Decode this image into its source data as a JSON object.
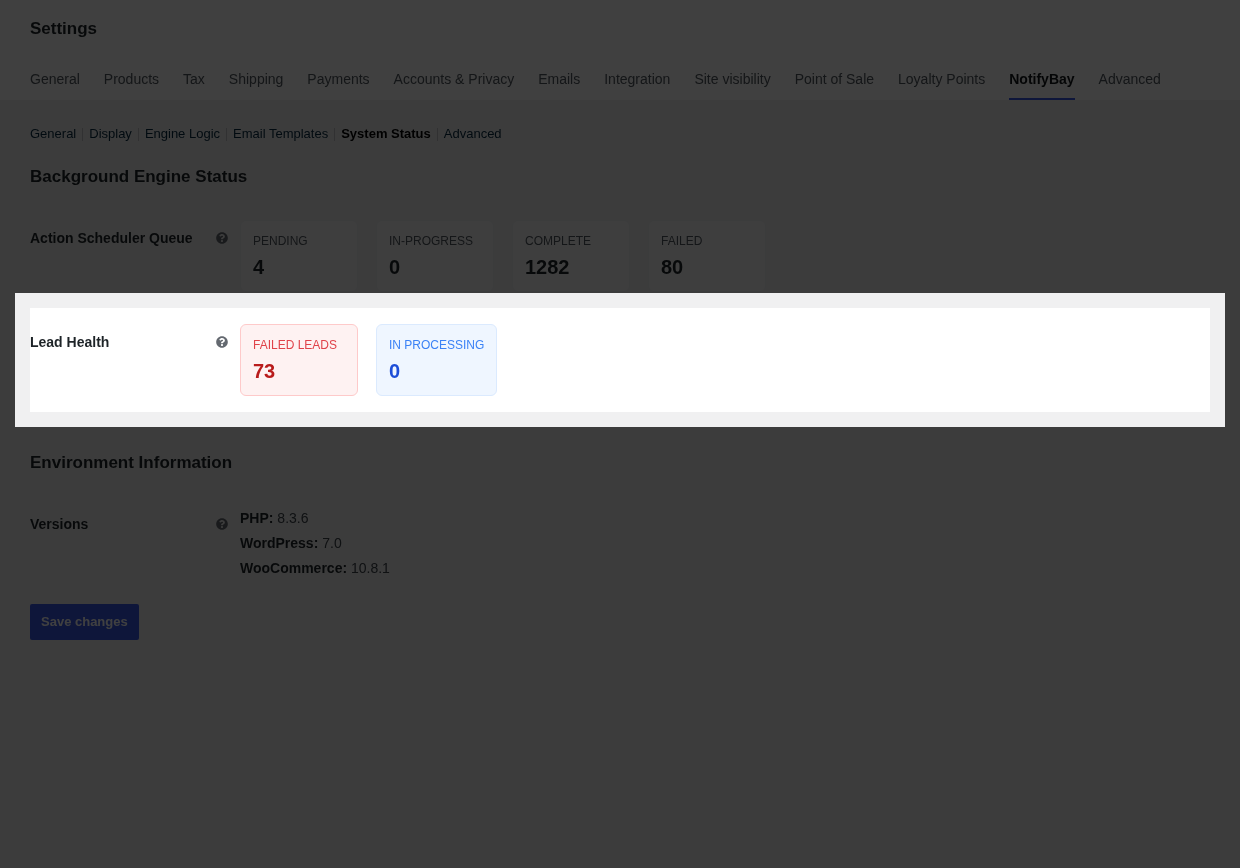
{
  "page_title": "Settings",
  "tabs": [
    {
      "label": "General",
      "selected": false
    },
    {
      "label": "Products",
      "selected": false
    },
    {
      "label": "Tax",
      "selected": false
    },
    {
      "label": "Shipping",
      "selected": false
    },
    {
      "label": "Payments",
      "selected": false
    },
    {
      "label": "Accounts & Privacy",
      "selected": false
    },
    {
      "label": "Emails",
      "selected": false
    },
    {
      "label": "Integration",
      "selected": false
    },
    {
      "label": "Site visibility",
      "selected": false
    },
    {
      "label": "Point of Sale",
      "selected": false
    },
    {
      "label": "Loyalty Points",
      "selected": false
    },
    {
      "label": "NotifyBay",
      "selected": true
    },
    {
      "label": "Advanced",
      "selected": false
    }
  ],
  "subtabs": [
    {
      "label": "General",
      "selected": false
    },
    {
      "label": "Display",
      "selected": false
    },
    {
      "label": "Engine Logic",
      "selected": false
    },
    {
      "label": "Email Templates",
      "selected": false
    },
    {
      "label": "System Status",
      "selected": true
    },
    {
      "label": "Advanced",
      "selected": false
    }
  ],
  "sections": [
    {
      "heading": "Background Engine Status",
      "rows": [
        {
          "label": "Action Scheduler Queue",
          "highlighted": false,
          "kind": "stats",
          "stats": [
            {
              "label": "PENDING",
              "value": "4",
              "kind": "neutral"
            },
            {
              "label": "IN-PROGRESS",
              "value": "0",
              "kind": "neutral"
            },
            {
              "label": "COMPLETE",
              "value": "1282",
              "kind": "neutral"
            },
            {
              "label": "FAILED",
              "value": "80",
              "kind": "neutral"
            }
          ]
        },
        {
          "label": "Lead Health",
          "highlighted": true,
          "kind": "stats",
          "stats": [
            {
              "label": "FAILED LEADS",
              "value": "73",
              "kind": "danger"
            },
            {
              "label": "IN PROCESSING",
              "value": "0",
              "kind": "info"
            }
          ]
        }
      ]
    },
    {
      "heading": "Environment Information",
      "rows": [
        {
          "label": "Versions",
          "highlighted": false,
          "kind": "lines",
          "lines": [
            "**PHP:** 8.3.6",
            "**WordPress:** 7.0",
            "**WooCommerce:** 10.8.1"
          ]
        }
      ]
    }
  ],
  "save_button": {
    "label": "Save changes"
  }
}
